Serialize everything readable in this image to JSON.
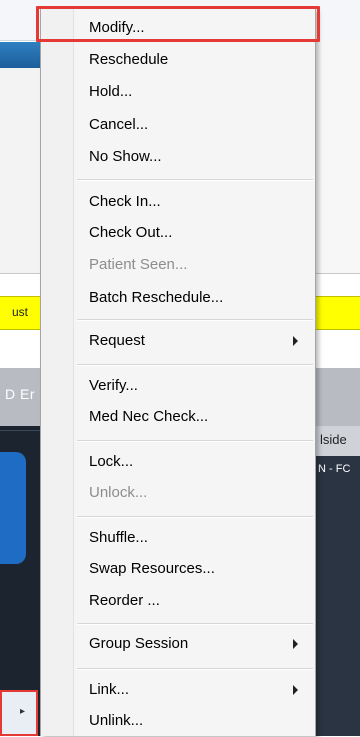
{
  "background": {
    "yellow_banner_text": "ust",
    "grid_header_text": "D Er",
    "column_header_text": "lside",
    "cell_text": "N - FC"
  },
  "menu": {
    "items": [
      {
        "label": "Modify...",
        "disabled": false,
        "submenu": false,
        "highlighted": true
      },
      {
        "label": "Reschedule",
        "disabled": false,
        "submenu": false
      },
      {
        "label": "Hold...",
        "disabled": false,
        "submenu": false
      },
      {
        "label": "Cancel...",
        "disabled": false,
        "submenu": false
      },
      {
        "label": "No Show...",
        "disabled": false,
        "submenu": false
      },
      {
        "label": "Check In...",
        "disabled": false,
        "submenu": false
      },
      {
        "label": "Check Out...",
        "disabled": false,
        "submenu": false
      },
      {
        "label": "Patient Seen...",
        "disabled": true,
        "submenu": false
      },
      {
        "label": "Batch Reschedule...",
        "disabled": false,
        "submenu": false
      },
      {
        "label": "Request",
        "disabled": false,
        "submenu": true
      },
      {
        "label": "Verify...",
        "disabled": false,
        "submenu": false
      },
      {
        "label": "Med Nec Check...",
        "disabled": false,
        "submenu": false
      },
      {
        "label": "Lock...",
        "disabled": false,
        "submenu": false
      },
      {
        "label": "Unlock...",
        "disabled": true,
        "submenu": false
      },
      {
        "label": "Shuffle...",
        "disabled": false,
        "submenu": false
      },
      {
        "label": "Swap Resources...",
        "disabled": false,
        "submenu": false
      },
      {
        "label": "Reorder ...",
        "disabled": false,
        "submenu": false
      },
      {
        "label": "Group Session",
        "disabled": false,
        "submenu": true
      },
      {
        "label": "Link...",
        "disabled": false,
        "submenu": true
      },
      {
        "label": "Unlink...",
        "disabled": false,
        "submenu": false
      }
    ]
  },
  "colors": {
    "highlight_outline": "#e53935",
    "disabled_text": "#8d8d8d",
    "banner_yellow": "#ffff00"
  }
}
